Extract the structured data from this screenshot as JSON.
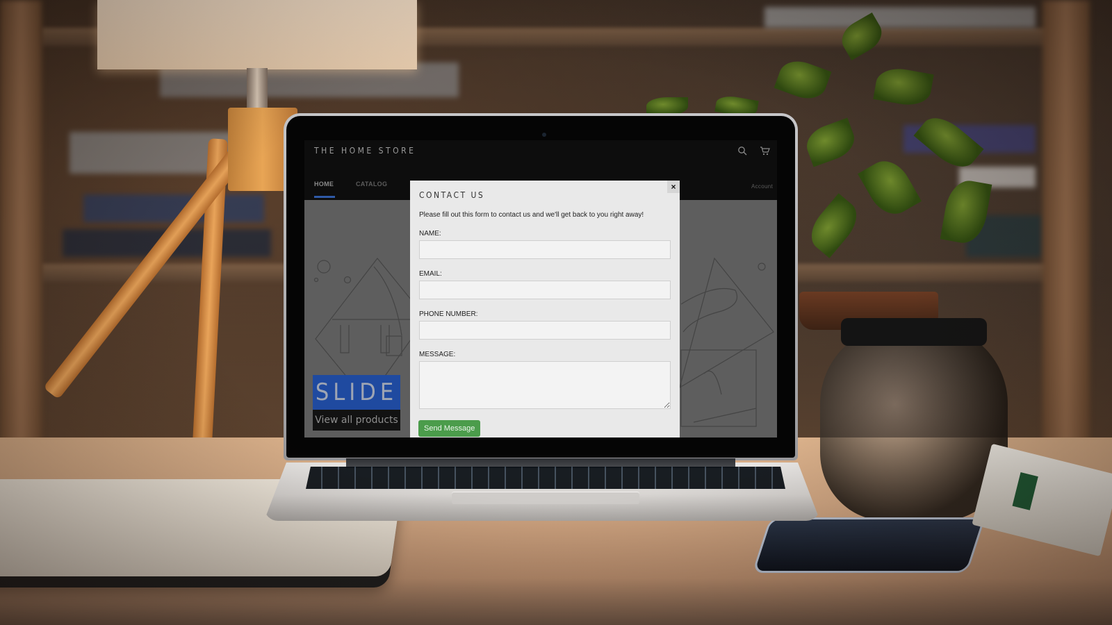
{
  "store": {
    "logo": "THE HOME STORE",
    "icons": {
      "search": "search-icon",
      "cart": "cart-icon"
    },
    "nav": {
      "items": [
        {
          "label": "HOME",
          "active": true
        },
        {
          "label": "CATALOG",
          "active": false
        }
      ],
      "account_label": "Account",
      "active_color": "#2f5aa7"
    },
    "hero": {
      "badge_text": "SLIDE",
      "badge_color": "#1f4aa0",
      "link_label": "View all products"
    }
  },
  "modal": {
    "title": "CONTACT US",
    "close_label": "×",
    "intro": "Please fill out this form to contact us and we'll get back to you right away!",
    "fields": [
      {
        "label": "NAME:",
        "value": "",
        "type": "text"
      },
      {
        "label": "EMAIL:",
        "value": "",
        "type": "email"
      },
      {
        "label": "PHONE NUMBER:",
        "value": "",
        "type": "tel"
      },
      {
        "label": "MESSAGE:",
        "value": "",
        "type": "textarea"
      }
    ],
    "submit_label": "Send Message",
    "submit_color": "#4b9c4b"
  }
}
